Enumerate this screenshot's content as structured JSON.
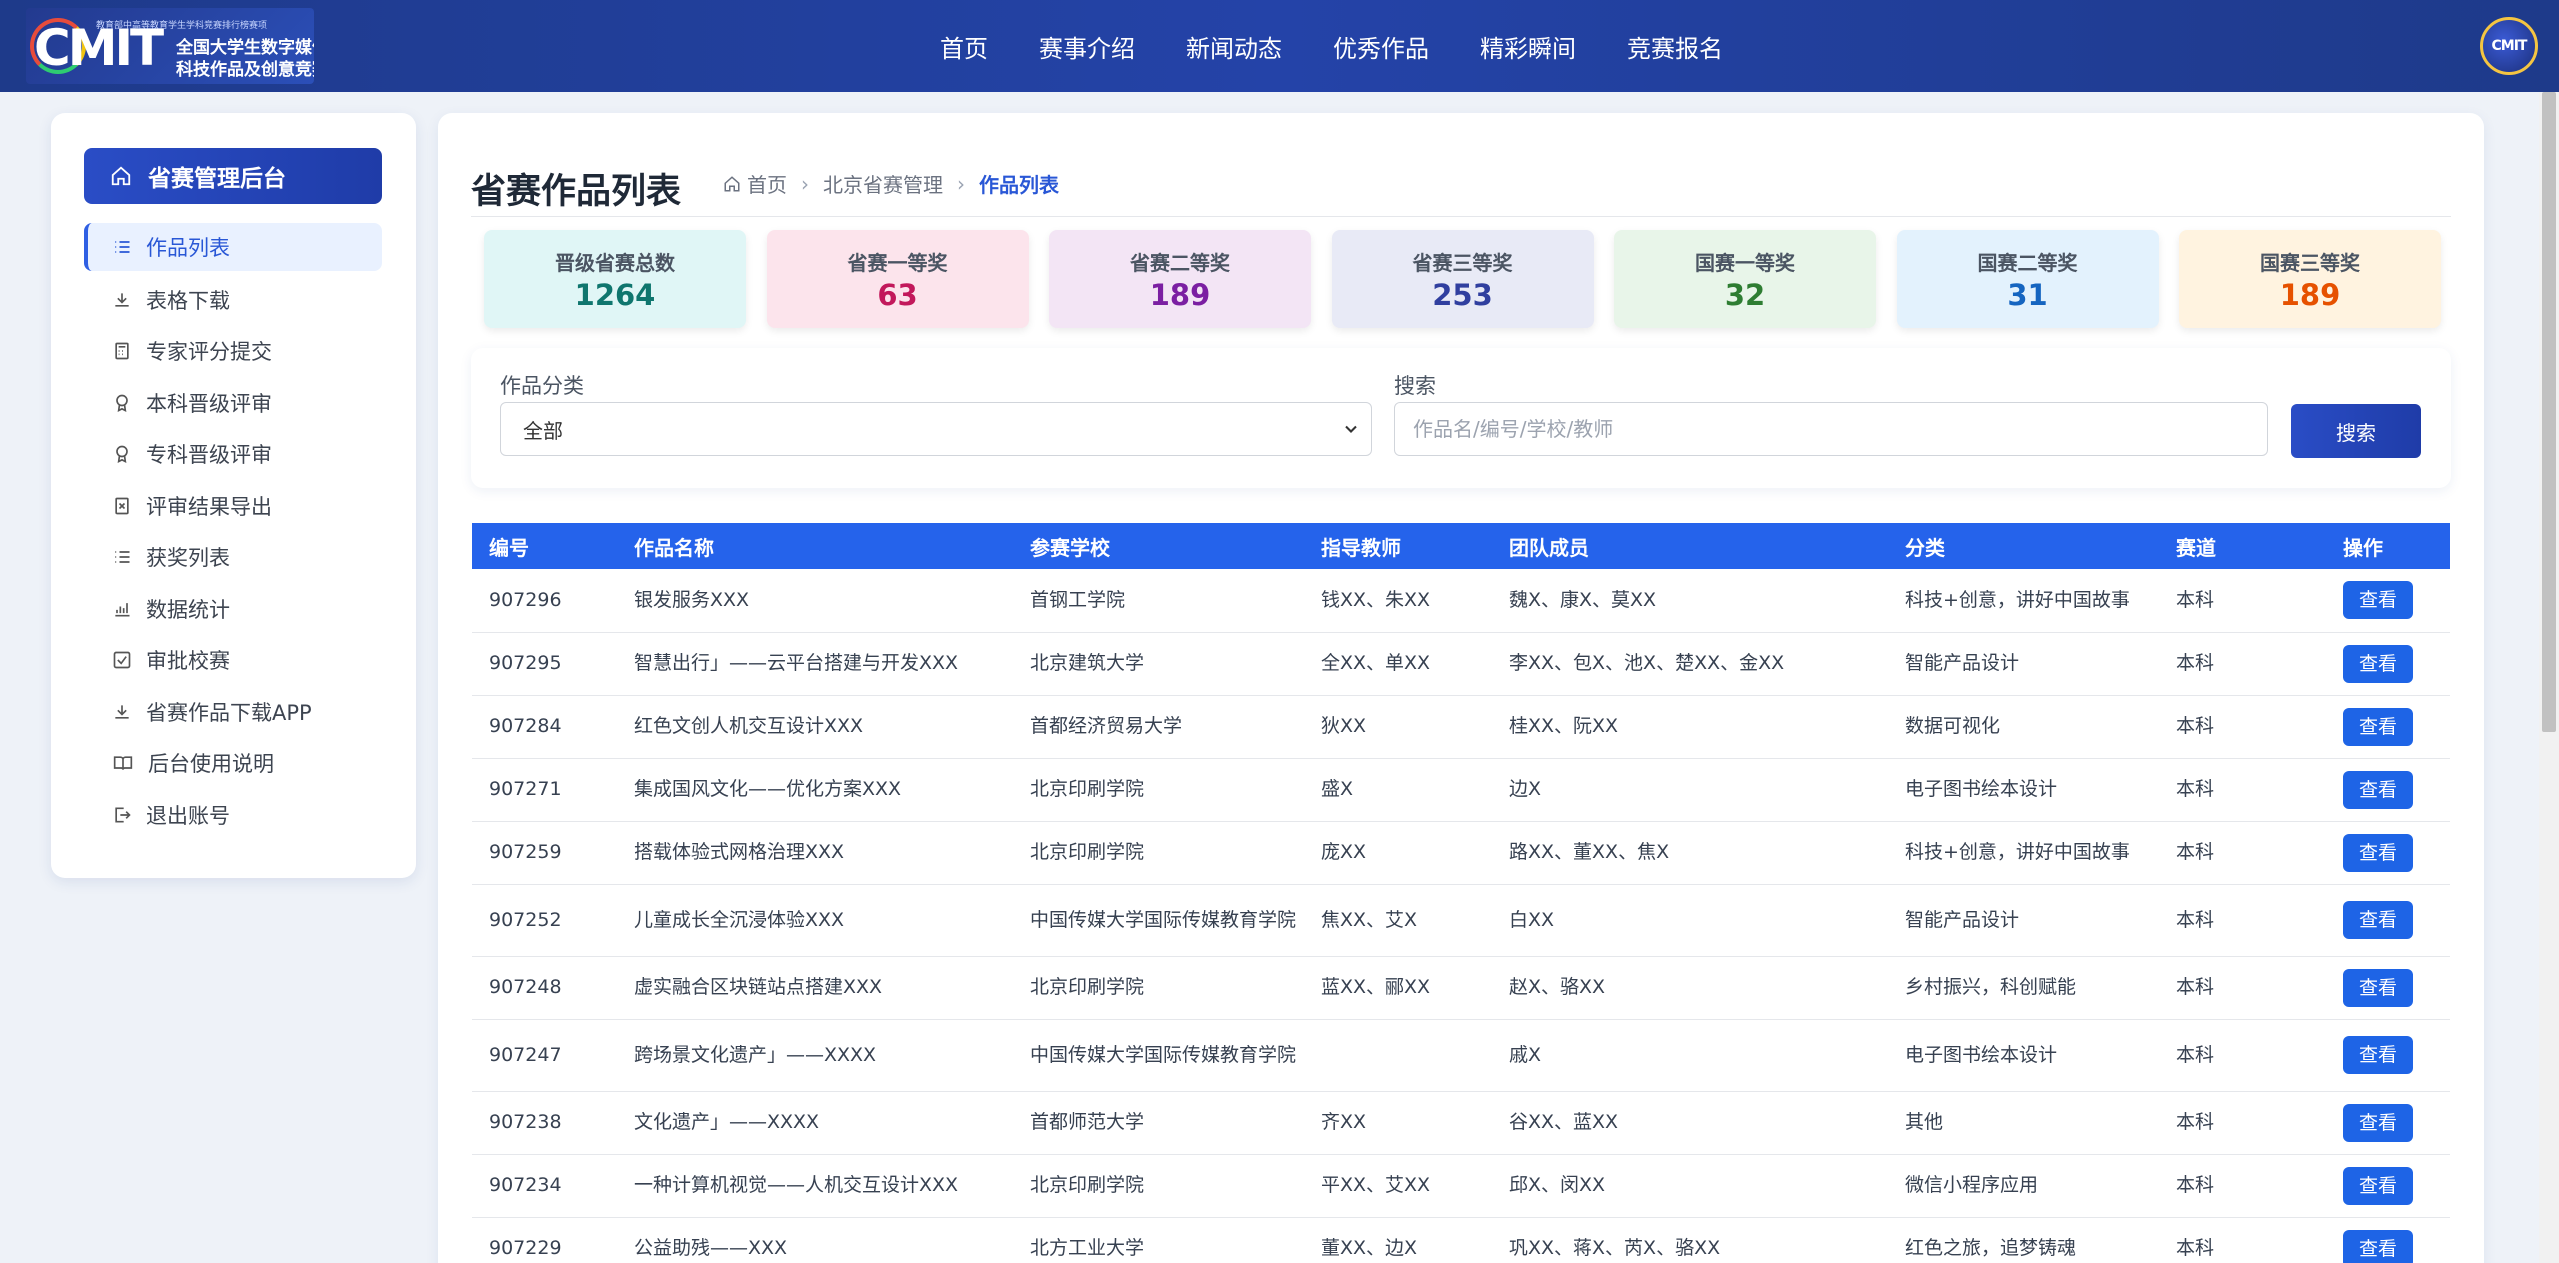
{
  "header": {
    "logo": {
      "mark": "CMIT",
      "top_text": "教育部中高等教育学生学科竞赛排行榜赛项",
      "line1": "全国大学生数字媒体",
      "line2": "科技作品及创意竞赛"
    },
    "nav": [
      "首页",
      "赛事介绍",
      "新闻动态",
      "优秀作品",
      "精彩瞬间",
      "竞赛报名"
    ],
    "avatar_text": "CMIT"
  },
  "sidebar": {
    "title": "省赛管理后台",
    "items": [
      {
        "label": "作品列表",
        "icon": "list-icon"
      },
      {
        "label": "表格下载",
        "icon": "download-icon"
      },
      {
        "label": "专家评分提交",
        "icon": "calculator-icon"
      },
      {
        "label": "本科晋级评审",
        "icon": "award-icon"
      },
      {
        "label": "专科晋级评审",
        "icon": "award-icon"
      },
      {
        "label": "评审结果导出",
        "icon": "export-icon"
      },
      {
        "label": "获奖列表",
        "icon": "list-icon"
      },
      {
        "label": "数据统计",
        "icon": "bar-chart-icon"
      },
      {
        "label": "审批校赛",
        "icon": "checkbox-icon"
      },
      {
        "label": "省赛作品下载APP",
        "icon": "download-icon"
      },
      {
        "label": "后台使用说明",
        "icon": "book-icon"
      },
      {
        "label": "退出账号",
        "icon": "logout-icon"
      }
    ]
  },
  "main": {
    "title": "省赛作品列表",
    "breadcrumb": {
      "home": "首页",
      "level2": "北京省赛管理",
      "current": "作品列表"
    }
  },
  "stats": [
    {
      "label": "晋级省赛总数",
      "value": "1264",
      "bg": "#e0f6f6",
      "color": "#0f766e"
    },
    {
      "label": "省赛一等奖",
      "value": "63",
      "bg": "#fce4ec",
      "color": "#c2185b"
    },
    {
      "label": "省赛二等奖",
      "value": "189",
      "bg": "#f3e5f5",
      "color": "#7b1fa2"
    },
    {
      "label": "省赛三等奖",
      "value": "253",
      "bg": "#e8eaf6",
      "color": "#303f9f"
    },
    {
      "label": "国赛一等奖",
      "value": "32",
      "bg": "#e8f5e9",
      "color": "#2e7d32"
    },
    {
      "label": "国赛二等奖",
      "value": "31",
      "bg": "#e3f2fd",
      "color": "#1565c0"
    },
    {
      "label": "国赛三等奖",
      "value": "189",
      "bg": "#fff3e0",
      "color": "#e65100"
    }
  ],
  "filter": {
    "category_label": "作品分类",
    "category_value": "全部",
    "search_label": "搜索",
    "search_placeholder": "作品名/编号/学校/教师",
    "search_value": "",
    "search_button": "搜索"
  },
  "table": {
    "columns": [
      "编号",
      "作品名称",
      "参赛学校",
      "指导教师",
      "团队成员",
      "分类",
      "赛道",
      "操作"
    ],
    "view_label": "查看",
    "rows": [
      {
        "id": "907296",
        "name": "银发服务XXX",
        "school": "首钢工学院",
        "teacher": "钱XX、朱XX",
        "members": "魏X、康X、莫XX",
        "category": "科技+创意，讲好中国故事",
        "track": "本科"
      },
      {
        "id": "907295",
        "name": "智慧出行」——云平台搭建与开发XXX",
        "school": "北京建筑大学",
        "teacher": "全XX、单XX",
        "members": "李XX、包X、池X、楚XX、金XX",
        "category": "智能产品设计",
        "track": "本科"
      },
      {
        "id": "907284",
        "name": "红色文创人机交互设计XXX",
        "school": "首都经济贸易大学",
        "teacher": "狄XX",
        "members": "桂XX、阮XX",
        "category": "数据可视化",
        "track": "本科"
      },
      {
        "id": "907271",
        "name": "集成国风文化——优化方案XXX",
        "school": "北京印刷学院",
        "teacher": "盛X",
        "members": "边X",
        "category": "电子图书绘本设计",
        "track": "本科"
      },
      {
        "id": "907259",
        "name": "搭载体验式网格治理XXX",
        "school": "北京印刷学院",
        "teacher": "庞XX",
        "members": "路XX、董XX、焦X",
        "category": "科技+创意，讲好中国故事",
        "track": "本科"
      },
      {
        "id": "907252",
        "name": "儿童成长全沉浸体验XXX",
        "school": "中国传媒大学国际传媒教育学院",
        "teacher": "焦XX、艾X",
        "members": "白XX",
        "category": "智能产品设计",
        "track": "本科"
      },
      {
        "id": "907248",
        "name": "虚实融合区块链站点搭建XXX",
        "school": "北京印刷学院",
        "teacher": "蓝XX、郦XX",
        "members": "赵X、骆XX",
        "category": "乡村振兴，科创赋能",
        "track": "本科"
      },
      {
        "id": "907247",
        "name": "跨场景文化遗产」——XXXX",
        "school": "中国传媒大学国际传媒教育学院",
        "teacher": "",
        "members": "戚X",
        "category": "电子图书绘本设计",
        "track": "本科"
      },
      {
        "id": "907238",
        "name": "文化遗产」——XXXX",
        "school": "首都师范大学",
        "teacher": "齐XX",
        "members": "谷XX、蓝XX",
        "category": "其他",
        "track": "本科"
      },
      {
        "id": "907234",
        "name": "一种计算机视觉——人机交互设计XXX",
        "school": "北京印刷学院",
        "teacher": "平XX、艾XX",
        "members": "邱X、闵XX",
        "category": "微信小程序应用",
        "track": "本科"
      },
      {
        "id": "907229",
        "name": "公益助残——XXX",
        "school": "北方工业大学",
        "teacher": "董XX、边X",
        "members": "巩XX、蒋X、芮X、骆XX",
        "category": "红色之旅，追梦铸魂",
        "track": "本科"
      }
    ]
  }
}
